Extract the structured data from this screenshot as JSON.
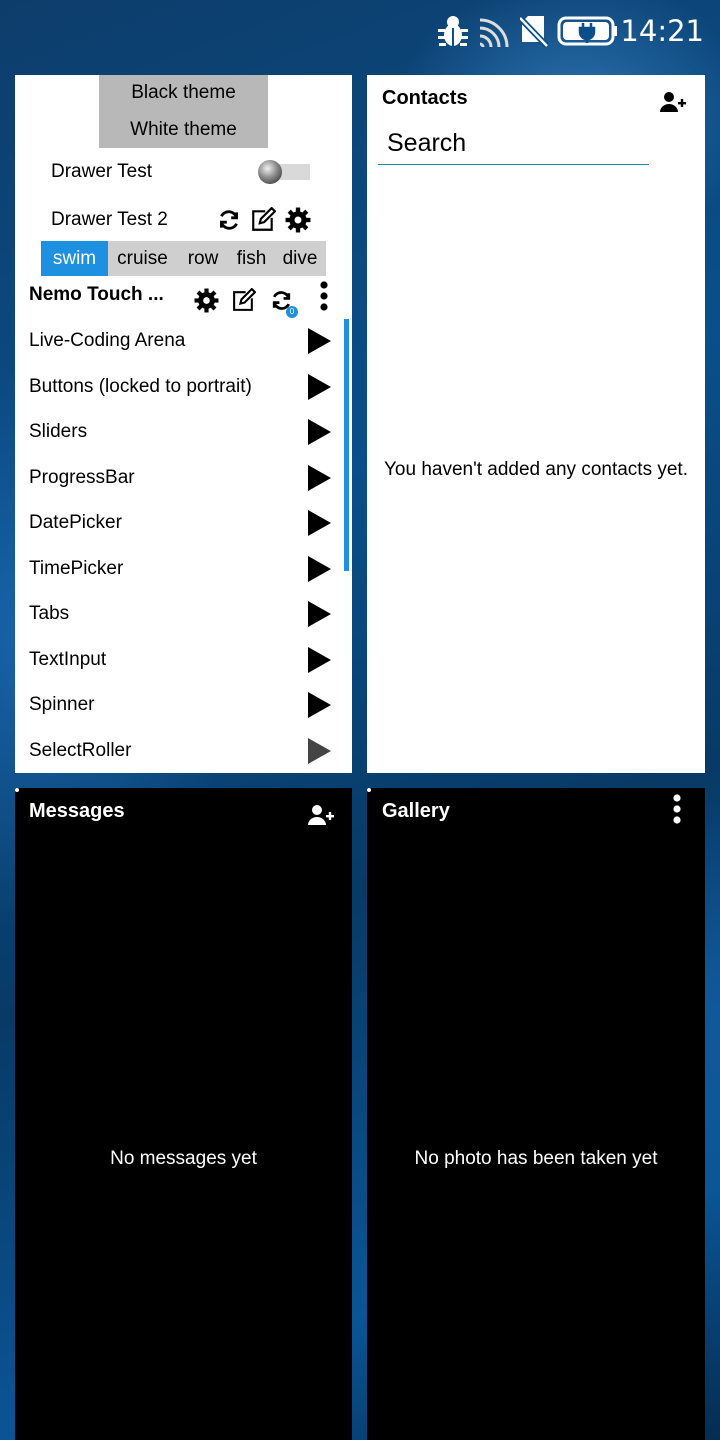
{
  "status_bar": {
    "time": "14:21",
    "icons": [
      "bug-icon",
      "cast-icon",
      "no-sim-icon",
      "battery-charging-icon"
    ]
  },
  "nemo_card": {
    "theme_menu": [
      "Black theme",
      "White theme"
    ],
    "drawer_test_label": "Drawer Test",
    "drawer_test_toggle_on": false,
    "drawer_test2_label": "Drawer Test 2",
    "tabs": [
      {
        "label": "swim",
        "active": true
      },
      {
        "label": "cruise",
        "active": false
      },
      {
        "label": "row",
        "active": false
      },
      {
        "label": "fish",
        "active": false
      },
      {
        "label": "dive",
        "active": false
      }
    ],
    "app_title": "Nemo Touch ...",
    "badge": "0",
    "items": [
      "Live-Coding Arena",
      "Buttons (locked to portrait)",
      "Sliders",
      "ProgressBar",
      "DatePicker",
      "TimePicker",
      "Tabs",
      "TextInput",
      "Spinner",
      "SelectRoller"
    ]
  },
  "contacts_card": {
    "title": "Contacts",
    "search_placeholder": "Search",
    "empty_text": "You haven't added any contacts yet."
  },
  "messages_card": {
    "title": "Messages",
    "empty_text": "No messages yet"
  },
  "gallery_card": {
    "title": "Gallery",
    "empty_text": "No photo has been taken yet"
  },
  "colors": {
    "accent": "#1e90e0",
    "menu_bg": "#b8b8b8",
    "tabs_bg": "#cfcfcf",
    "search_underline": "#1a8aa6"
  }
}
